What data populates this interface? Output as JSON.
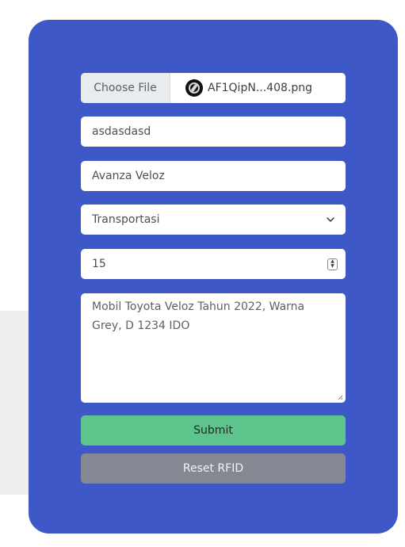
{
  "form": {
    "file": {
      "choose_label": "Choose File",
      "file_name": "AF1QipN...408.png"
    },
    "name_value": "asdasdasd",
    "model_value": "Avanza Veloz",
    "category": {
      "selected": "Transportasi"
    },
    "quantity_value": "15",
    "description_value": "Mobil Toyota Veloz Tahun 2022, Warna Grey, D 1234 IDO",
    "submit_label": "Submit",
    "reset_label": "Reset RFID"
  },
  "colors": {
    "card": "#3f58c7",
    "submit": "#5dc48b",
    "reset": "#858893"
  },
  "icons": {
    "file_thumb": "file-thumbnail-icon",
    "select": "chevron-down-icon",
    "number": "spinner-icon",
    "textarea": "resize-handle-icon"
  }
}
